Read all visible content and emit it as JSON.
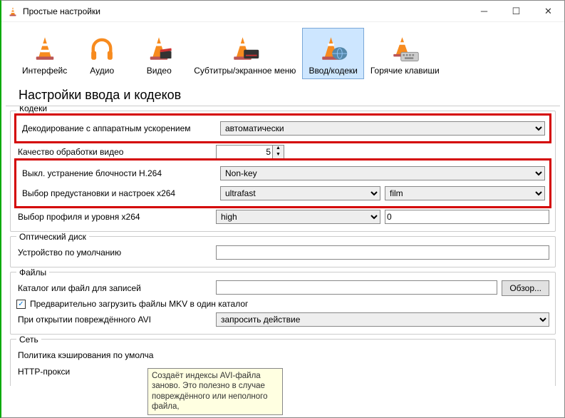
{
  "window": {
    "title": "Простые настройки"
  },
  "tabs": {
    "interface": "Интерфейс",
    "audio": "Аудио",
    "video": "Видео",
    "subtitles": "Субтитры/экранное меню",
    "input": "Ввод/кодеки",
    "hotkeys": "Горячие клавиши"
  },
  "heading": "Настройки ввода и кодеков",
  "groups": {
    "codecs": {
      "title": "Кодеки",
      "hwdecode": {
        "label": "Декодирование с аппаратным ускорением",
        "value": "автоматически"
      },
      "quality": {
        "label": "Качество обработки видео",
        "value": "5"
      },
      "h264skip": {
        "label": "Выкл. устранение блочности H.264",
        "value": "Non-key"
      },
      "x264preset": {
        "label": "Выбор предустановки и настроек x264",
        "preset": "ultrafast",
        "tune": "film"
      },
      "x264profile": {
        "label": "Выбор профиля и уровня x264",
        "profile": "high",
        "level": "0"
      }
    },
    "disc": {
      "title": "Оптический диск",
      "default_device": {
        "label": "Устройство по умолчанию",
        "value": ""
      }
    },
    "files": {
      "title": "Файлы",
      "record_path": {
        "label": "Каталог или файл для записей",
        "value": "",
        "browse": "Обзор..."
      },
      "mkv_preload": {
        "label": "Предварительно загрузить файлы MKV в один каталог",
        "checked": true
      },
      "broken_avi": {
        "label": "При открытии повреждённого AVI",
        "value": "запросить действие"
      }
    },
    "network": {
      "title": "Сеть",
      "cache_policy": {
        "label": "Политика кэширования по умолча"
      },
      "http_proxy": {
        "label": "HTTP-прокси"
      }
    }
  },
  "tooltip": "Создаёт индексы AVI-файла заново. Это полезно в случае повреждённого или неполного файла,"
}
